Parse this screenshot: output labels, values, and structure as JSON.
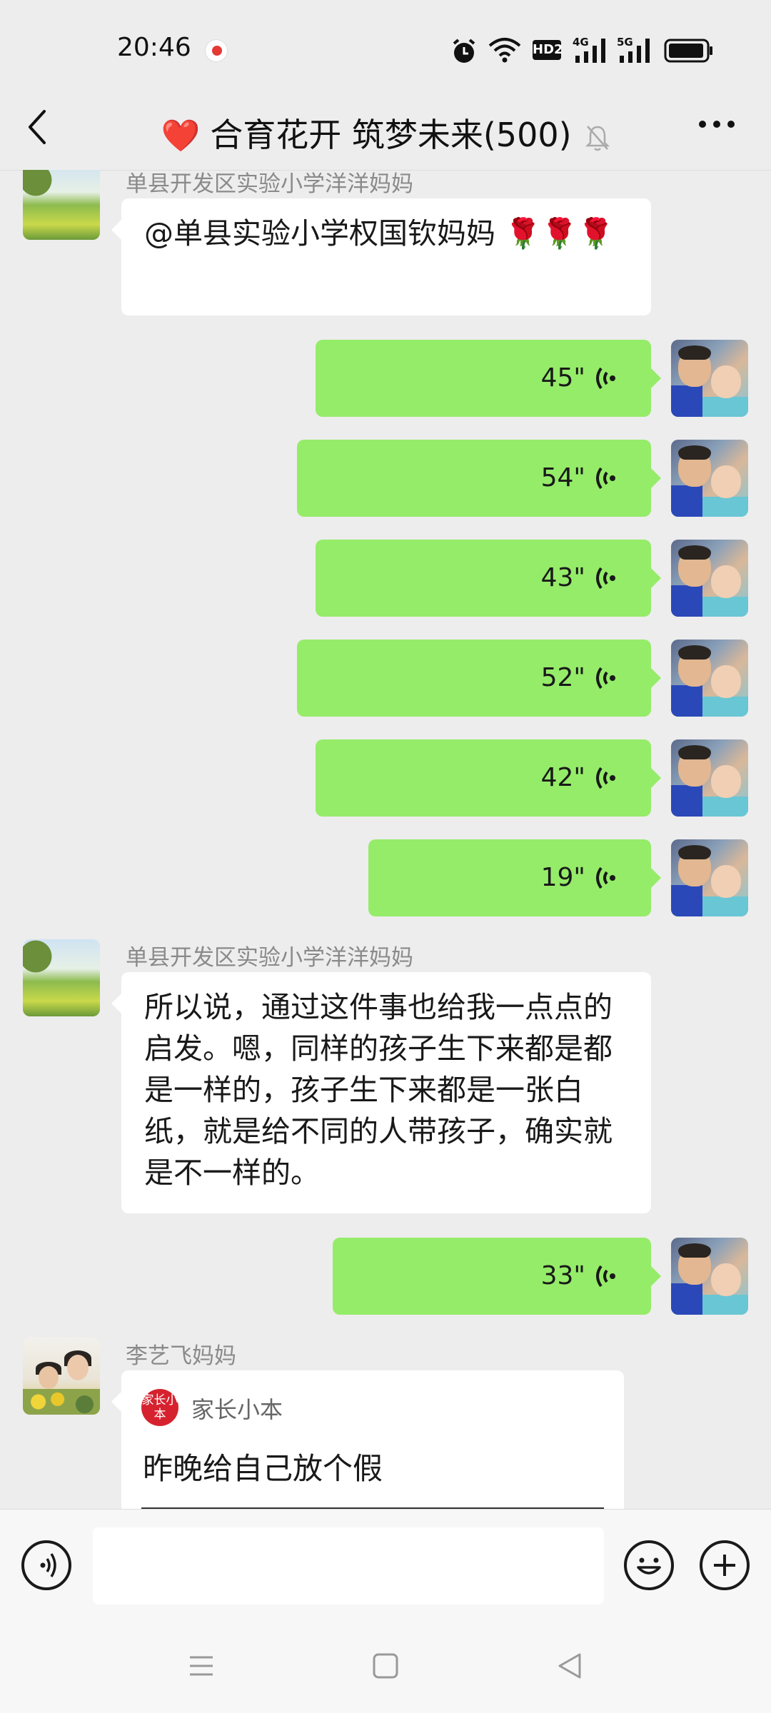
{
  "status_bar": {
    "time": "20:46",
    "icons": [
      "record-icon",
      "alarm-icon",
      "wifi-icon",
      "hd2-icon",
      "signal-4g-icon",
      "signal-5g-icon",
      "battery-icon"
    ],
    "network_labels": {
      "hd": "HD2",
      "net1": "4G",
      "net2": "5G"
    }
  },
  "header": {
    "title_emoji": "❤️",
    "title": "合育花开 筑梦未来(500)",
    "back_icon": "chevron-left-icon",
    "mute_icon": "bell-muted-icon",
    "more_icon": "more-icon"
  },
  "messages": [
    {
      "type": "text_in",
      "sender": "单县开发区实验小学洋洋妈妈",
      "text": "@单县实验小学权国钦妈妈 🌹🌹🌹"
    },
    {
      "type": "voice_out",
      "duration": "45\""
    },
    {
      "type": "voice_out",
      "duration": "54\""
    },
    {
      "type": "voice_out",
      "duration": "43\""
    },
    {
      "type": "voice_out",
      "duration": "52\""
    },
    {
      "type": "voice_out",
      "duration": "42\""
    },
    {
      "type": "voice_out",
      "duration": "19\""
    },
    {
      "type": "text_in",
      "sender": "单县开发区实验小学洋洋妈妈",
      "text": "所以说，通过这件事也给我一点点的启发。嗯，同样的孩子生下来都是都是一样的，孩子生下来都是一张白纸，就是给不同的人带孩子，确实就是不一样的。"
    },
    {
      "type": "voice_out",
      "duration": "33\""
    },
    {
      "type": "card_in",
      "sender": "李艺飞妈妈",
      "source_logo": "家长小本",
      "source": "家长小本",
      "title": "昨晚给自己放个假"
    }
  ],
  "input_bar": {
    "voice_icon": "voice-input-icon",
    "emoji_icon": "emoji-icon",
    "plus_icon": "plus-icon",
    "value": ""
  },
  "nav_bar": {
    "icons": [
      "menu-icon",
      "home-icon",
      "back-icon"
    ]
  },
  "colors": {
    "background": "#ededed",
    "bubble_out": "#95ec69",
    "bubble_in": "#ffffff",
    "accent_red": "#e53935"
  }
}
